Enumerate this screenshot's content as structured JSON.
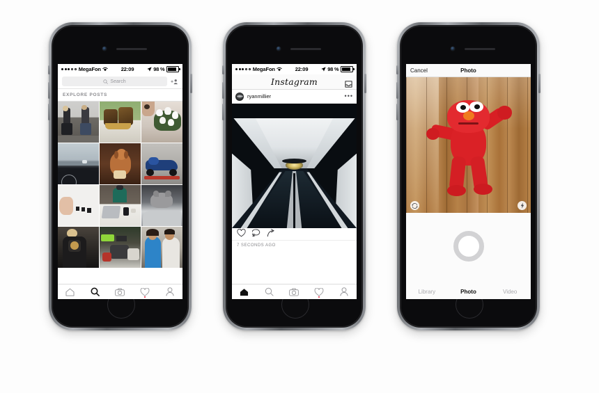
{
  "scene": {
    "background_color": "#fdfdfd",
    "device_count": 3,
    "device_model": "iPhone (space gray)"
  },
  "status_bar": {
    "signal_dots": "●●●○○",
    "carrier": "MegaFon",
    "wifi_icon": "wifi-icon",
    "time": "22:09",
    "location_icon": "location-arrow-icon",
    "battery_text": "98 %",
    "battery_icon": "battery-icon"
  },
  "phone1": {
    "name": "explore-screen",
    "search": {
      "icon": "search-icon",
      "placeholder": "Search",
      "add_user_icon": "add-person-icon"
    },
    "section_header": "EXPLORE POSTS",
    "grid": [
      [
        {
          "name": "woman-sitting-bench",
          "alt": "Two women sitting on a bench"
        },
        {
          "name": "louis-vuitton-bags",
          "alt": "Designer handbags on green wall"
        },
        {
          "name": "white-tulips",
          "alt": "Bouquet of white tulips"
        }
      ],
      [
        {
          "name": "car-dashboard",
          "alt": "Car dashboard at dusk"
        },
        {
          "name": "golden-dog",
          "alt": "Golden retriever lying down"
        },
        {
          "name": "blue-motorcycle",
          "alt": "Blue sport motorcycle on stand"
        }
      ],
      [
        {
          "name": "hand-minimal-objects",
          "alt": "Hand with small black cubes"
        },
        {
          "name": "desk-flatlay",
          "alt": "Laptop desk flat lay from above"
        },
        {
          "name": "cat-in-car",
          "alt": "Grey cat on car seat"
        }
      ],
      [
        {
          "name": "woman-with-camera",
          "alt": "Woman holding a camera"
        },
        {
          "name": "garage-workshop",
          "alt": "Engine parts in a workshop"
        },
        {
          "name": "couple-portrait",
          "alt": "Smiling couple portrait"
        }
      ]
    ],
    "tabbar": {
      "active": "search",
      "items": [
        {
          "name": "home",
          "icon": "home-icon",
          "active": false,
          "badge": false
        },
        {
          "name": "search",
          "icon": "search-icon",
          "active": true,
          "badge": false
        },
        {
          "name": "camera",
          "icon": "camera-icon",
          "active": false,
          "badge": false
        },
        {
          "name": "activity",
          "icon": "heart-icon",
          "active": false,
          "badge": true
        },
        {
          "name": "profile",
          "icon": "person-icon",
          "active": false,
          "badge": false
        }
      ]
    }
  },
  "phone2": {
    "name": "feed-screen",
    "navbar": {
      "title": "Instagram",
      "inbox_icon": "inbox-tray-icon"
    },
    "post": {
      "avatar": "user-avatar",
      "username": "ryanmillier",
      "more_icon": "more-options-icon",
      "photo": {
        "name": "subway-escalator",
        "alt": "Symmetrical subway escalator tunnel"
      },
      "actions": [
        {
          "name": "like",
          "icon": "heart-icon"
        },
        {
          "name": "comment",
          "icon": "comment-icon"
        },
        {
          "name": "share",
          "icon": "share-arrow-icon"
        }
      ],
      "timestamp": "7 SECONDS AGO"
    },
    "tabbar": {
      "active": "home",
      "items": [
        {
          "name": "home",
          "icon": "home-icon",
          "active": true,
          "badge": false
        },
        {
          "name": "search",
          "icon": "search-icon",
          "active": false,
          "badge": false
        },
        {
          "name": "camera",
          "icon": "camera-icon",
          "active": false,
          "badge": false
        },
        {
          "name": "activity",
          "icon": "heart-icon",
          "active": false,
          "badge": true
        },
        {
          "name": "profile",
          "icon": "person-icon",
          "active": false,
          "badge": false
        }
      ]
    }
  },
  "phone3": {
    "name": "camera-screen",
    "topbar": {
      "cancel_label": "Cancel",
      "title": "Photo"
    },
    "viewfinder": {
      "photo": {
        "name": "elmo-plush-on-wood-floor",
        "alt": "Red Elmo plush toy on wooden floor"
      },
      "flip_camera_icon": "camera-flip-icon",
      "flash_icon": "flash-bolt-icon"
    },
    "shutter_button": "shutter-button",
    "modes": [
      {
        "label": "Library",
        "active": false
      },
      {
        "label": "Photo",
        "active": true
      },
      {
        "label": "Video",
        "active": false
      }
    ]
  }
}
